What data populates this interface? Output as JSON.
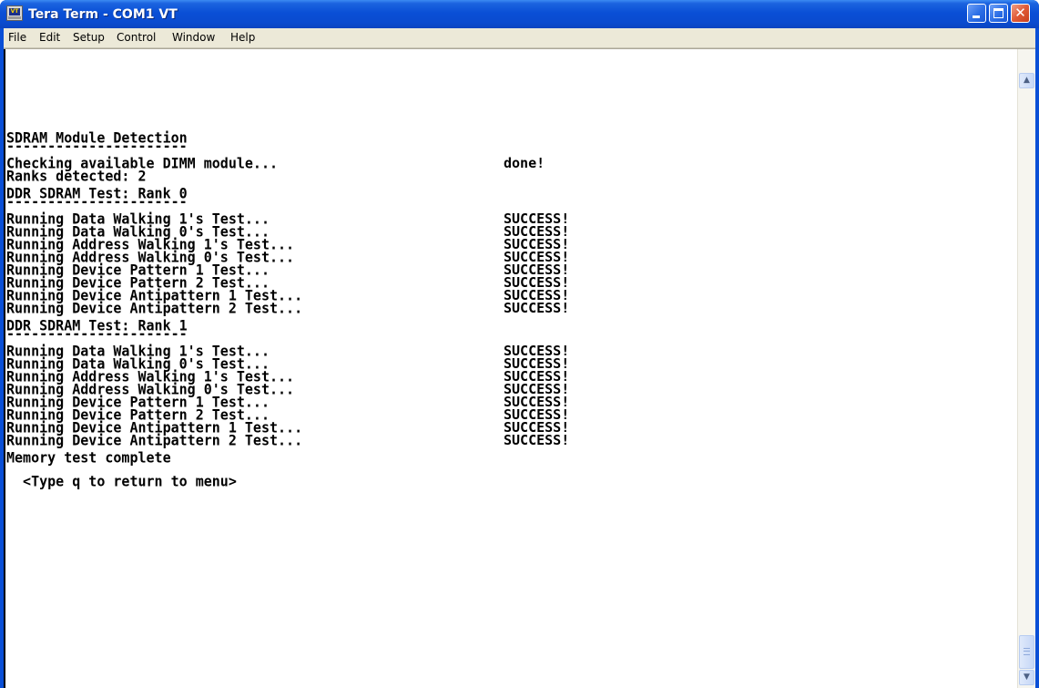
{
  "window": {
    "title": "Tera Term - COM1 VT",
    "icon": "teraterm-app-icon",
    "icon_text": "VT",
    "colors": {
      "titlebar": "#0a4fd6",
      "menubar": "#ece9d8",
      "terminal_bg": "#ffffff",
      "terminal_fg": "#000000",
      "close_button": "#e05a36"
    }
  },
  "menu": {
    "items": [
      "File",
      "Edit",
      "Setup",
      "Control",
      "Window",
      "Help"
    ]
  },
  "terminal": {
    "lines": [
      {
        "left": "SDRAM Module Detection",
        "right": ""
      },
      {
        "left": "----------------------",
        "right": ""
      },
      {
        "left": "Checking available DIMM module...",
        "right": "done!"
      },
      {
        "left": "Ranks detected: 2",
        "right": ""
      },
      {
        "left": "DDR SDRAM Test: Rank 0",
        "right": ""
      },
      {
        "left": "----------------------",
        "right": ""
      },
      {
        "left": "Running Data Walking 1's Test...",
        "right": "SUCCESS!"
      },
      {
        "left": "Running Data Walking 0's Test...",
        "right": "SUCCESS!"
      },
      {
        "left": "Running Address Walking 1's Test...",
        "right": "SUCCESS!"
      },
      {
        "left": "Running Address Walking 0's Test...",
        "right": "SUCCESS!"
      },
      {
        "left": "Running Device Pattern 1 Test...",
        "right": "SUCCESS!"
      },
      {
        "left": "Running Device Pattern 2 Test...",
        "right": "SUCCESS!"
      },
      {
        "left": "Running Device Antipattern 1 Test...",
        "right": "SUCCESS!"
      },
      {
        "left": "Running Device Antipattern 2 Test...",
        "right": "SUCCESS!"
      },
      {
        "left": "DDR SDRAM Test: Rank 1",
        "right": ""
      },
      {
        "left": "----------------------",
        "right": ""
      },
      {
        "left": "Running Data Walking 1's Test...",
        "right": "SUCCESS!"
      },
      {
        "left": "Running Data Walking 0's Test...",
        "right": "SUCCESS!"
      },
      {
        "left": "Running Address Walking 1's Test...",
        "right": "SUCCESS!"
      },
      {
        "left": "Running Address Walking 0's Test...",
        "right": "SUCCESS!"
      },
      {
        "left": "Running Device Pattern 1 Test...",
        "right": "SUCCESS!"
      },
      {
        "left": "Running Device Pattern 2 Test...",
        "right": "SUCCESS!"
      },
      {
        "left": "Running Device Antipattern 1 Test...",
        "right": "SUCCESS!"
      },
      {
        "left": "Running Device Antipattern 2 Test...",
        "right": "SUCCESS!"
      },
      {
        "left": "Memory test complete",
        "right": ""
      },
      {
        "left": "  <Type q to return to menu>",
        "right": ""
      }
    ]
  },
  "scrollbar": {
    "position": 1.0,
    "up_icon": "scroll-up-arrow-icon",
    "down_icon": "scroll-down-arrow-icon"
  }
}
